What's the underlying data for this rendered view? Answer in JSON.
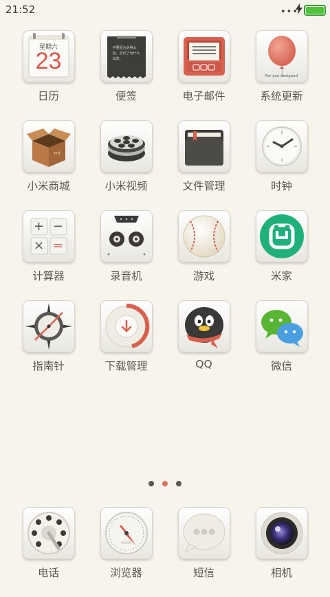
{
  "status_bar": {
    "time": "21:52",
    "signal_icon": "more-dots-icon",
    "charging_icon": "bolt-icon",
    "battery_icon": "battery-full-icon",
    "battery_color": "#4fc43a"
  },
  "home_screen": {
    "rows": [
      [
        {
          "label": "日历",
          "icon": "calendar-icon",
          "weekday": "星期六",
          "day": "23"
        },
        {
          "label": "便签",
          "icon": "notes-icon",
          "note_text": "不要因为走得太远，忘记了为什么出发。"
        },
        {
          "label": "电子邮件",
          "icon": "email-icon"
        },
        {
          "label": "系统更新",
          "icon": "balloon-update-icon",
          "tagline": "For you designed"
        }
      ],
      [
        {
          "label": "小米商城",
          "icon": "box-store-icon",
          "box_mark": "mi"
        },
        {
          "label": "小米视频",
          "icon": "film-reel-icon"
        },
        {
          "label": "文件管理",
          "icon": "folder-icon"
        },
        {
          "label": "时钟",
          "icon": "clock-icon"
        }
      ],
      [
        {
          "label": "计算器",
          "icon": "calculator-icon",
          "keys": [
            "+",
            "−",
            "×",
            "="
          ]
        },
        {
          "label": "录音机",
          "icon": "cassette-recorder-icon"
        },
        {
          "label": "游戏",
          "icon": "baseball-icon"
        },
        {
          "label": "米家",
          "icon": "mijia-icon"
        }
      ],
      [
        {
          "label": "指南针",
          "icon": "compass-icon"
        },
        {
          "label": "下载管理",
          "icon": "download-icon"
        },
        {
          "label": "QQ",
          "icon": "qq-penguin-icon"
        },
        {
          "label": "微信",
          "icon": "wechat-icon"
        }
      ]
    ],
    "page_indicator": {
      "pages": 3,
      "active_page": 2
    },
    "accent_color": "#d8745f"
  },
  "dock": [
    {
      "label": "电话",
      "icon": "phone-dial-icon"
    },
    {
      "label": "浏览器",
      "icon": "speedometer-browser-icon"
    },
    {
      "label": "短信",
      "icon": "message-bubble-icon"
    },
    {
      "label": "相机",
      "icon": "camera-lens-icon"
    }
  ]
}
